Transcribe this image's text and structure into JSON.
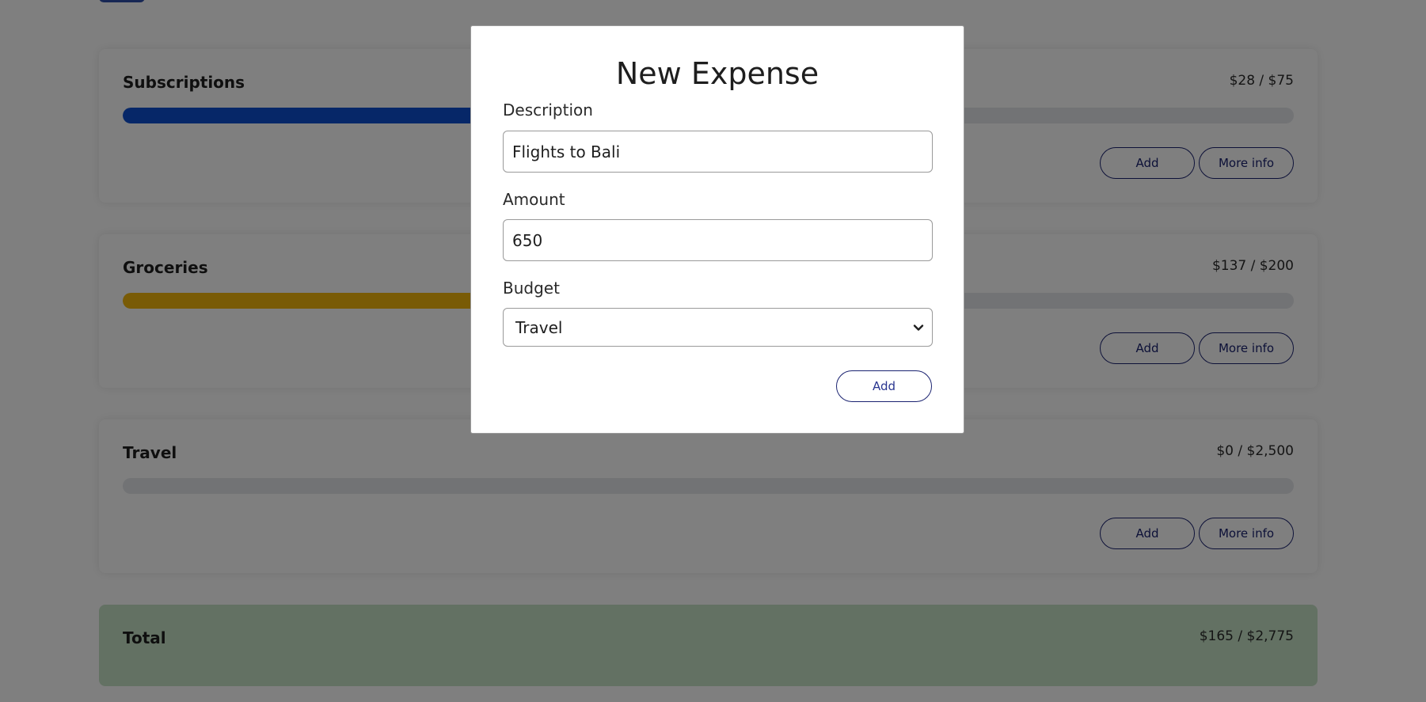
{
  "budgets": [
    {
      "name": "Subscriptions",
      "amount": "$28 / $75",
      "progress": 0.373,
      "color": "#0d4fd0",
      "add_label": "Add",
      "more_label": "More info"
    },
    {
      "name": "Groceries",
      "amount": "$137 / $200",
      "progress": 0.685,
      "color": "#f2b70c",
      "add_label": "Add",
      "more_label": "More info"
    },
    {
      "name": "Travel",
      "amount": "$0 / $2,500",
      "progress": 0,
      "color": "#0d4fd0",
      "add_label": "Add",
      "more_label": "More info"
    }
  ],
  "total": {
    "label": "Total",
    "amount": "$165 / $2,775"
  },
  "modal": {
    "title": "New Expense",
    "description_label": "Description",
    "description_value": "Flights to Bali",
    "amount_label": "Amount",
    "amount_value": "650",
    "budget_label": "Budget",
    "budget_selected": "Travel",
    "submit_label": "Add"
  },
  "colors": {
    "overlay": "rgba(0,0,0,0.5)",
    "button_border": "#1a2270",
    "total_background": "#c6e3c7"
  }
}
